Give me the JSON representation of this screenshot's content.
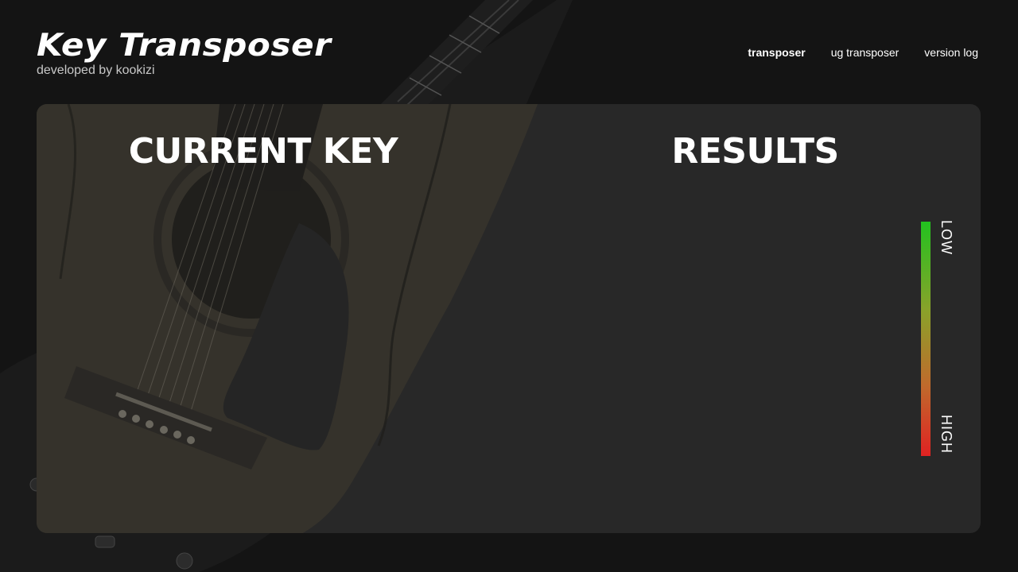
{
  "header": {
    "title": "Key Transposer",
    "subtitle": "developed by kookizi"
  },
  "nav": {
    "items": [
      {
        "label": "transposer",
        "active": true
      },
      {
        "label": "ug transposer",
        "active": false
      },
      {
        "label": "version log",
        "active": false
      }
    ]
  },
  "main": {
    "current_key_title": "CURRENT KEY",
    "results_title": "RESULTS",
    "range": {
      "low_label": "LOW",
      "high_label": "HIGH"
    }
  },
  "colors": {
    "background": "#141414",
    "panel": "#282828",
    "range_low": "#22c21f",
    "range_high": "#e02222"
  }
}
